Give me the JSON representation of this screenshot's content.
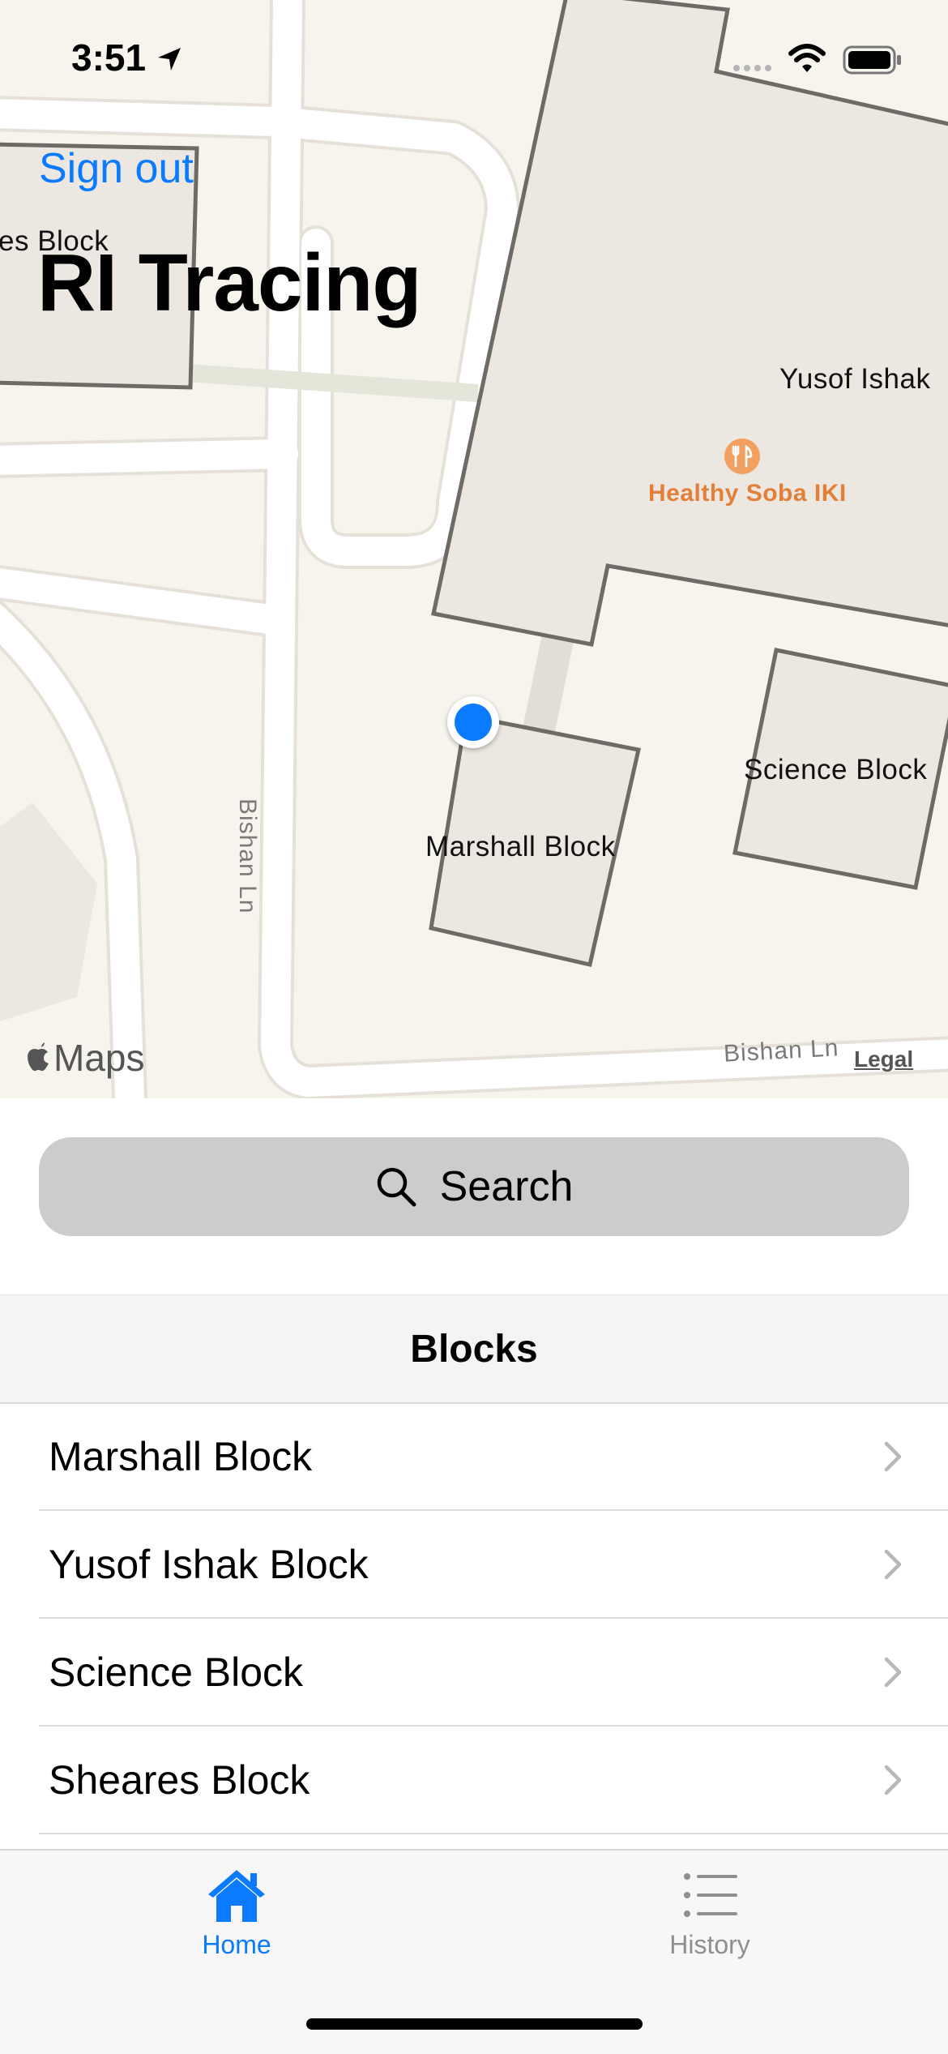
{
  "status_bar": {
    "time": "3:51"
  },
  "header": {
    "signout_label": "Sign out",
    "title": "RI Tracing"
  },
  "map": {
    "labels": {
      "sheares_partial": "es Block",
      "yusof": "Yusof Ishak",
      "science": "Science Block",
      "marshall": "Marshall Block",
      "poi": "Healthy Soba IKI",
      "road_vertical": "Bishan Ln",
      "road_bottom": "Bishan Ln"
    },
    "attribution": {
      "brand": "Maps",
      "legal": "Legal"
    }
  },
  "search": {
    "label": "Search"
  },
  "blocks": {
    "header": "Blocks",
    "items": [
      {
        "label": "Marshall Block"
      },
      {
        "label": "Yusof Ishak Block"
      },
      {
        "label": "Science Block"
      },
      {
        "label": "Sheares Block"
      }
    ]
  },
  "tabbar": {
    "tabs": [
      {
        "label": "Home",
        "icon": "house-icon",
        "active": true
      },
      {
        "label": "History",
        "icon": "list-icon",
        "active": false
      }
    ]
  },
  "colors": {
    "accent": "#0a7aff",
    "inactive": "#8e8e93",
    "poi": "#e27f39"
  }
}
